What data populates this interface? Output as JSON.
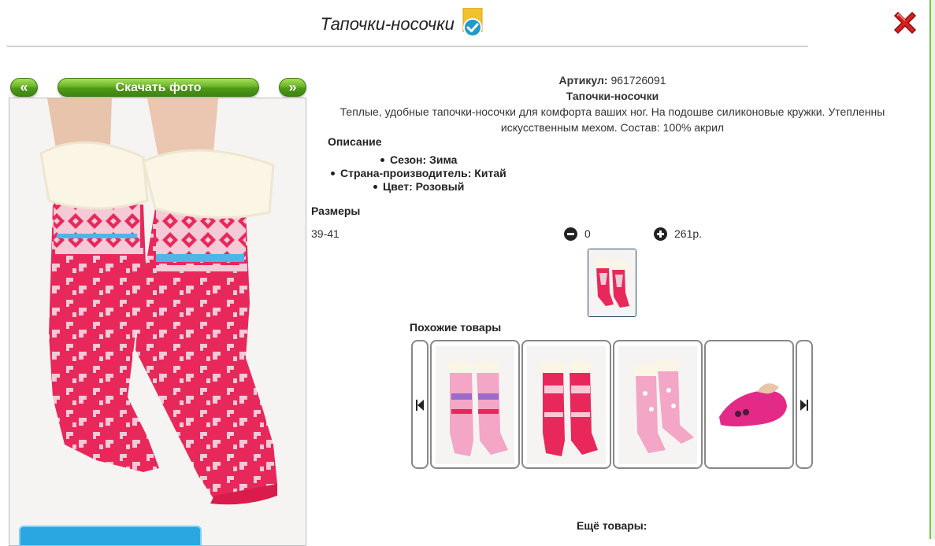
{
  "modal": {
    "title": "Тапочки-носочки",
    "verified_icon": "verified-check-badge",
    "close_icon": "red-x-close"
  },
  "gallery": {
    "prev_label": "«",
    "next_label": "»",
    "download_label": "Скачать фото"
  },
  "product": {
    "article_label": "Артикул:",
    "article_value": "961726091",
    "name": "Тапочки-носочки",
    "description_line1": "Теплые, удобные тапочки-носочки для комфорта ваших ног. На подошве силиконовые кружки. Утепленны",
    "description_line2": "искусственным мехом. Состав: 100% акрил",
    "description_heading": "Описание",
    "props": [
      "Сезон: Зима",
      "Страна-производитель: Китай",
      "Цвет: Розовый"
    ]
  },
  "sizes": {
    "heading": "Размеры",
    "rows": [
      {
        "size": "39-41",
        "quantity": "0",
        "price": "261р."
      }
    ],
    "minus_icon": "minus-circle-icon",
    "plus_icon": "plus-circle-icon"
  },
  "similar": {
    "heading": "Похожие товары",
    "prev_icon": "skip-prev-icon",
    "next_icon": "skip-next-icon",
    "items": [
      "pink-purple-socks",
      "pink-red-socks",
      "light-pink-socks",
      "pink-slipper"
    ]
  },
  "more": {
    "heading": "Ещё товары:"
  },
  "colors": {
    "accent_green": "#6bb52a",
    "sock_red": "#e8285a",
    "close_red": "#d62020"
  }
}
